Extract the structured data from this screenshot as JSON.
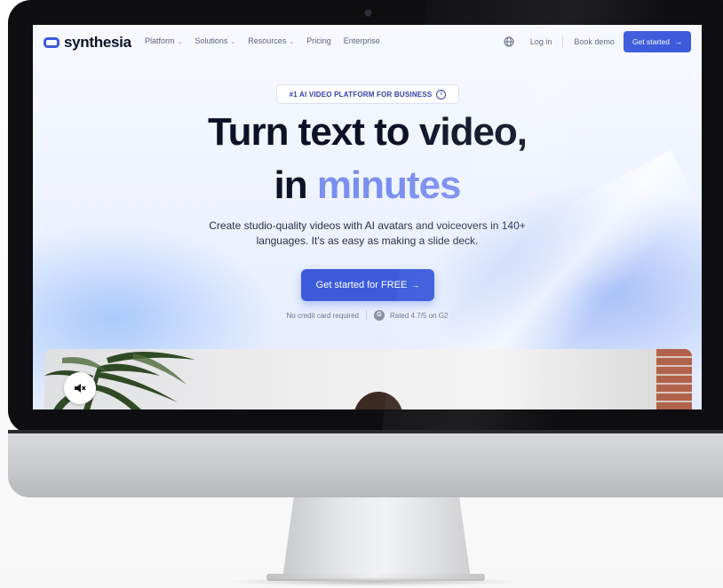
{
  "brand": {
    "name": "synthesia",
    "accent": "#3b5bdb"
  },
  "nav": {
    "menu": [
      {
        "label": "Platform",
        "dropdown": true
      },
      {
        "label": "Solutions",
        "dropdown": true
      },
      {
        "label": "Resources",
        "dropdown": true
      },
      {
        "label": "Pricing",
        "dropdown": false
      },
      {
        "label": "Enterprise",
        "dropdown": false
      }
    ],
    "globe_icon": "globe-icon",
    "login_label": "Log in",
    "book_demo_label": "Book demo",
    "cta_label": "Get started",
    "cta_arrow": "→"
  },
  "hero": {
    "badge": "#1 AI VIDEO PLATFORM FOR BUSINESS",
    "title_line1": "Turn text to video,",
    "title_line2_prefix": "in ",
    "title_line2_accent": "minutes",
    "subtitle_line1": "Create studio-quality videos with AI avatars and voiceovers in 140+",
    "subtitle_line2": "languages. It's as easy as making a slide deck.",
    "cta_label": "Get started for FREE",
    "cta_arrow": "→",
    "trust_note": "No credit card required",
    "rating_text": "Rated 4.7/5 on G2",
    "g2_letter": "G"
  },
  "video": {
    "mute_icon": "speaker-muted-icon"
  }
}
